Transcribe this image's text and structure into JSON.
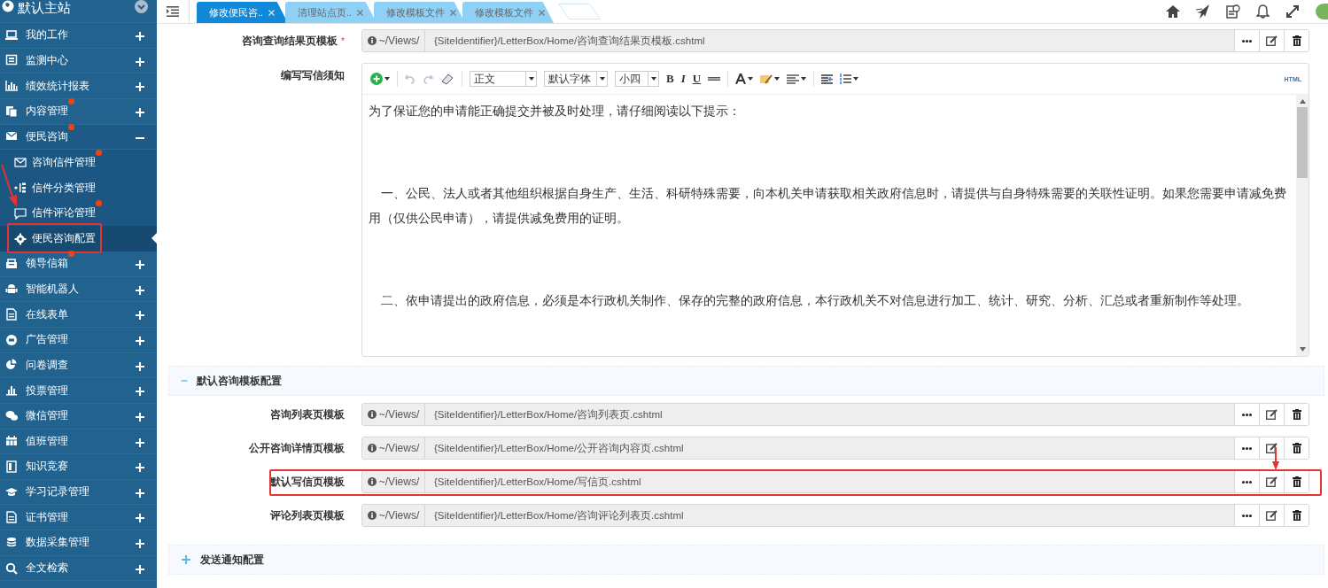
{
  "sidebar": {
    "site_title": "默认主站",
    "items": [
      {
        "label": "我的工作",
        "expanded": false,
        "dot": false
      },
      {
        "label": "监测中心",
        "expanded": false,
        "dot": false
      },
      {
        "label": "绩效统计报表",
        "expanded": false,
        "dot": false
      },
      {
        "label": "内容管理",
        "expanded": false,
        "dot": true
      },
      {
        "label": "便民咨询",
        "expanded": true,
        "dot": true,
        "children": [
          {
            "label": "咨询信件管理",
            "dot": true,
            "selected": false,
            "highlighted": false
          },
          {
            "label": "信件分类管理",
            "dot": false,
            "selected": false,
            "highlighted": false
          },
          {
            "label": "信件评论管理",
            "dot": true,
            "selected": false,
            "highlighted": false
          },
          {
            "label": "便民咨询配置",
            "dot": false,
            "selected": true,
            "highlighted": true
          }
        ]
      },
      {
        "label": "领导信箱",
        "expanded": false,
        "dot": true
      },
      {
        "label": "智能机器人",
        "expanded": false,
        "dot": false
      },
      {
        "label": "在线表单",
        "expanded": false,
        "dot": false
      },
      {
        "label": "广告管理",
        "expanded": false,
        "dot": false
      },
      {
        "label": "问卷调查",
        "expanded": false,
        "dot": false
      },
      {
        "label": "投票管理",
        "expanded": false,
        "dot": false
      },
      {
        "label": "微信管理",
        "expanded": false,
        "dot": false
      },
      {
        "label": "值班管理",
        "expanded": false,
        "dot": false
      },
      {
        "label": "知识竞赛",
        "expanded": false,
        "dot": false
      },
      {
        "label": "学习记录管理",
        "expanded": false,
        "dot": false
      },
      {
        "label": "证书管理",
        "expanded": false,
        "dot": false
      },
      {
        "label": "数据采集管理",
        "expanded": false,
        "dot": false
      },
      {
        "label": "全文检索",
        "expanded": false,
        "dot": false
      }
    ]
  },
  "tabs": [
    {
      "label": "修改便民咨..",
      "selected": true
    },
    {
      "label": "清理站点页..",
      "selected": false
    },
    {
      "label": "修改模板文件",
      "selected": false
    },
    {
      "label": "修改模板文件",
      "selected": false
    }
  ],
  "top_form": [
    {
      "kind": "path",
      "label": "咨询查询结果页模板",
      "required_mark": "*",
      "prefix": "~/Views/",
      "value": "{SiteIdentifier}/LetterBox/Home/咨询查询结果页模板.cshtml",
      "highlighted": false
    },
    {
      "kind": "editor",
      "label": "编写写信须知",
      "styles": [
        "正文",
        "默认字体",
        "小四"
      ],
      "format_buttons": [
        "B",
        "I",
        "U"
      ],
      "html_label": "HTML",
      "paragraphs": [
        "为了保证您的申请能正确提交并被及时处理，请仔细阅读以下提示：",
        "　一、公民、法人或者其他组织根据自身生产、生活、科研特殊需要，向本机关申请获取相关政府信息时，请提供与自身特殊需要的关联性证明。如果您需要申请减免费用（仅供公民申请），请提供减免费用的证明。",
        "　二、依申请提出的政府信息，必须是本行政机关制作、保存的完整的政府信息，本行政机关不对信息进行加工、统计、研究、分析、汇总或者重新制作等处理。"
      ]
    }
  ],
  "sections": [
    {
      "title": "默认咨询模板配置",
      "expanded": true,
      "rows": [
        {
          "label": "咨询列表页模板",
          "prefix": "~/Views/",
          "value": "{SiteIdentifier}/LetterBox/Home/咨询列表页.cshtml",
          "highlighted": false
        },
        {
          "label": "公开咨询详情页模板",
          "prefix": "~/Views/",
          "value": "{SiteIdentifier}/LetterBox/Home/公开咨询内容页.cshtml",
          "highlighted": false
        },
        {
          "label": "默认写信页模板",
          "prefix": "~/Views/",
          "value": "{SiteIdentifier}/LetterBox/Home/写信页.cshtml",
          "highlighted": true
        },
        {
          "label": "评论列表页模板",
          "prefix": "~/Views/",
          "value": "{SiteIdentifier}/LetterBox/Home/咨询评论列表页.cshtml",
          "highlighted": false
        }
      ]
    },
    {
      "title": "发送通知配置",
      "expanded": false
    }
  ]
}
